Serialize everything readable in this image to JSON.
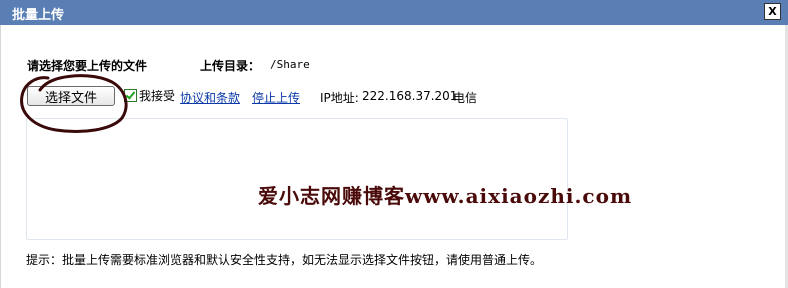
{
  "window": {
    "title": "批量上传",
    "close_glyph": "X"
  },
  "form": {
    "choose_label": "请选择您要上传的文件",
    "dir_label": "上传目录：",
    "dir_value": "/Share",
    "choose_button": "选择文件",
    "agree_checked": true,
    "agree_label": "我接受",
    "terms_link": "协议和条款",
    "stop_link": "停止上传",
    "ip_label": "IP地址:",
    "ip_value": "222.168.37.201",
    "carrier": "电信"
  },
  "watermark": "爱小志网赚博客www.aixiaozhi.com",
  "tip": "提示：批量上传需要标准浏览器和默认安全性支持，如无法显示选择文件按钮，请使用普通上传。",
  "colors": {
    "titlebar": "#5a7fb5",
    "link": "#0b3aa8",
    "annotation_circle": "#3a0a0a",
    "watermark": "#4a0a0a"
  }
}
